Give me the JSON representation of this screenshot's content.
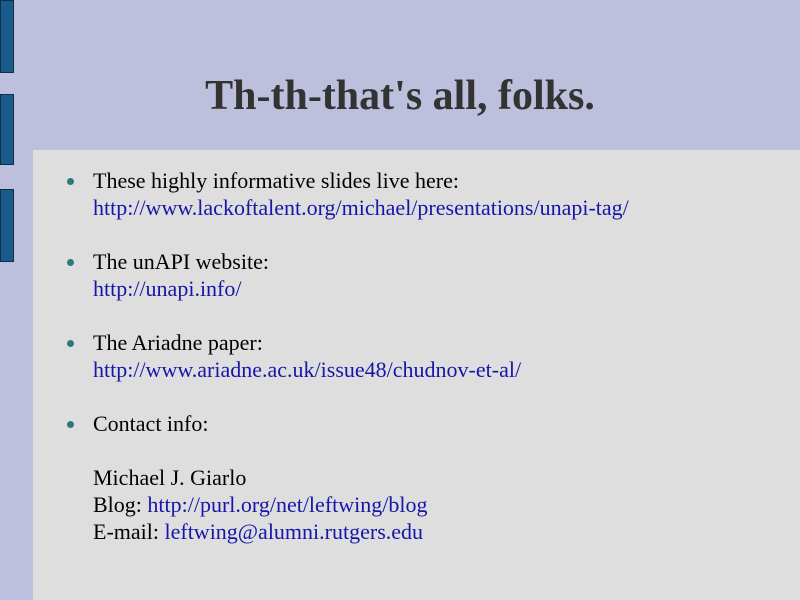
{
  "slide": {
    "title": "Th-th-that's all, folks.",
    "items": [
      {
        "label": "These highly informative slides live here:",
        "link": "http://www.lackoftalent.org/michael/presentations/unapi-tag/"
      },
      {
        "label": "The unAPI website:",
        "link": "http://unapi.info/"
      },
      {
        "label": "The Ariadne paper:",
        "link": "http://www.ariadne.ac.uk/issue48/chudnov-et-al/"
      }
    ],
    "contact": {
      "label": "Contact info:",
      "name": "Michael J. Giarlo",
      "blog_label": "Blog: ",
      "blog_link": "http://purl.org/net/leftwing/blog",
      "email_label": "E-mail: ",
      "email_link": "leftwing@alumni.rutgers.edu"
    }
  },
  "colors": {
    "background": "#bcc0dc",
    "panel": "#dedede",
    "tab": "#195b8a",
    "link": "#1616a8",
    "bullet": "#2b7a78",
    "title": "#333333"
  }
}
